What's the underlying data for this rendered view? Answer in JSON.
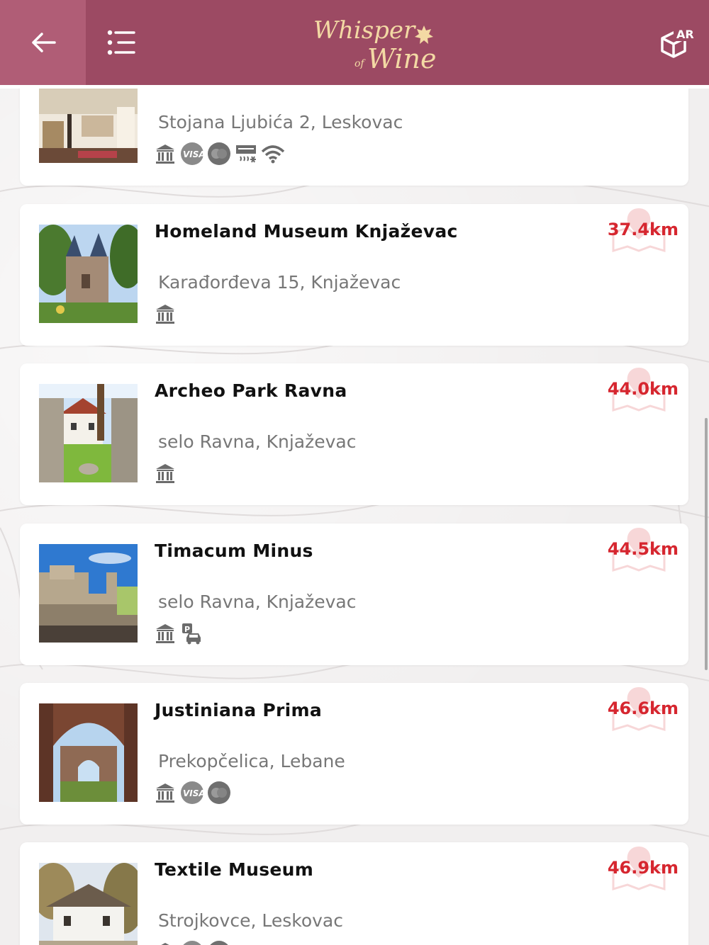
{
  "app": {
    "logo_line1": "Whisper",
    "logo_of": "of",
    "logo_line2": "Wine",
    "ar_label": "AR"
  },
  "colors": {
    "header": "#9c4a63",
    "header_back": "#b05d76",
    "distance": "#d6262f",
    "logo_gold": "#f3d9a4"
  },
  "items": [
    {
      "title": "",
      "address": "Stojana Ljubića 2, Leskovac",
      "distance": "",
      "amenities": [
        "museum-icon",
        "visa-icon",
        "mastercard-icon",
        "air-conditioning-icon",
        "wifi-icon"
      ]
    },
    {
      "title": "Homeland Museum Knjaževac",
      "address": "Karađorđeva 15, Knjaževac",
      "distance": "37.4km",
      "amenities": [
        "museum-icon"
      ]
    },
    {
      "title": "Archeo Park Ravna",
      "address": "selo Ravna, Knjaževac",
      "distance": "44.0km",
      "amenities": [
        "museum-icon"
      ]
    },
    {
      "title": "Timacum Minus",
      "address": "selo Ravna, Knjaževac",
      "distance": "44.5km",
      "amenities": [
        "museum-icon",
        "parking-icon"
      ]
    },
    {
      "title": "Justiniana Prima",
      "address": "Prekopčelica, Lebane",
      "distance": "46.6km",
      "amenities": [
        "museum-icon",
        "visa-icon",
        "mastercard-icon"
      ]
    },
    {
      "title": "Textile Museum",
      "address": "Strojkovce, Leskovac",
      "distance": "46.9km",
      "amenities": [
        "museum-icon",
        "visa-icon",
        "mastercard-icon"
      ]
    }
  ]
}
